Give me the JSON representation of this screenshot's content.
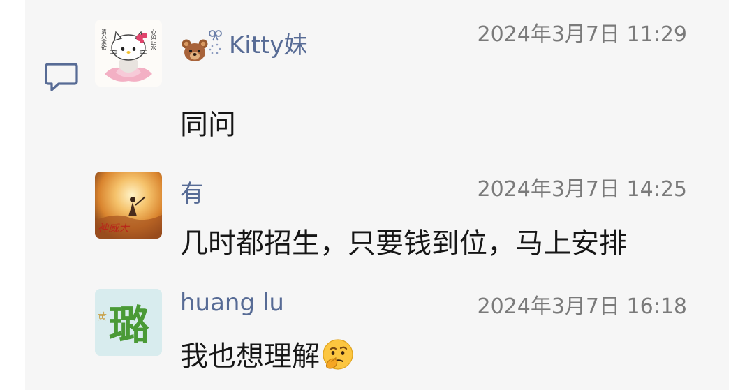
{
  "messages": [
    {
      "name": "Kitty妹",
      "time": "2024年3月7日 11:29",
      "content": "同问",
      "avatar_icon": "hello-kitty-lotus-avatar",
      "avatar_text_left": "清心寡欲",
      "avatar_text_right": "心如止水",
      "name_prefix_icon": "bear-bow-icon"
    },
    {
      "name": "有",
      "time": "2024年3月7日 14:25",
      "content": "几时都招生，只要钱到位，马上安排",
      "avatar_icon": "fiery-figure-avatar",
      "avatar_text": "神威大"
    },
    {
      "name": "huang lu",
      "time": "2024年3月7日 16:18",
      "content": "我也想理解",
      "avatar_icon": "calligraphy-lu-avatar",
      "avatar_text_small": "黄",
      "avatar_text_big": "璐",
      "content_emoji_icon": "thinking-face-icon"
    }
  ],
  "side_icon": "comment-icon",
  "colors": {
    "name": "#576b95",
    "time": "#7a7a7a",
    "content": "#161616",
    "panel": "#f6f6f6"
  }
}
